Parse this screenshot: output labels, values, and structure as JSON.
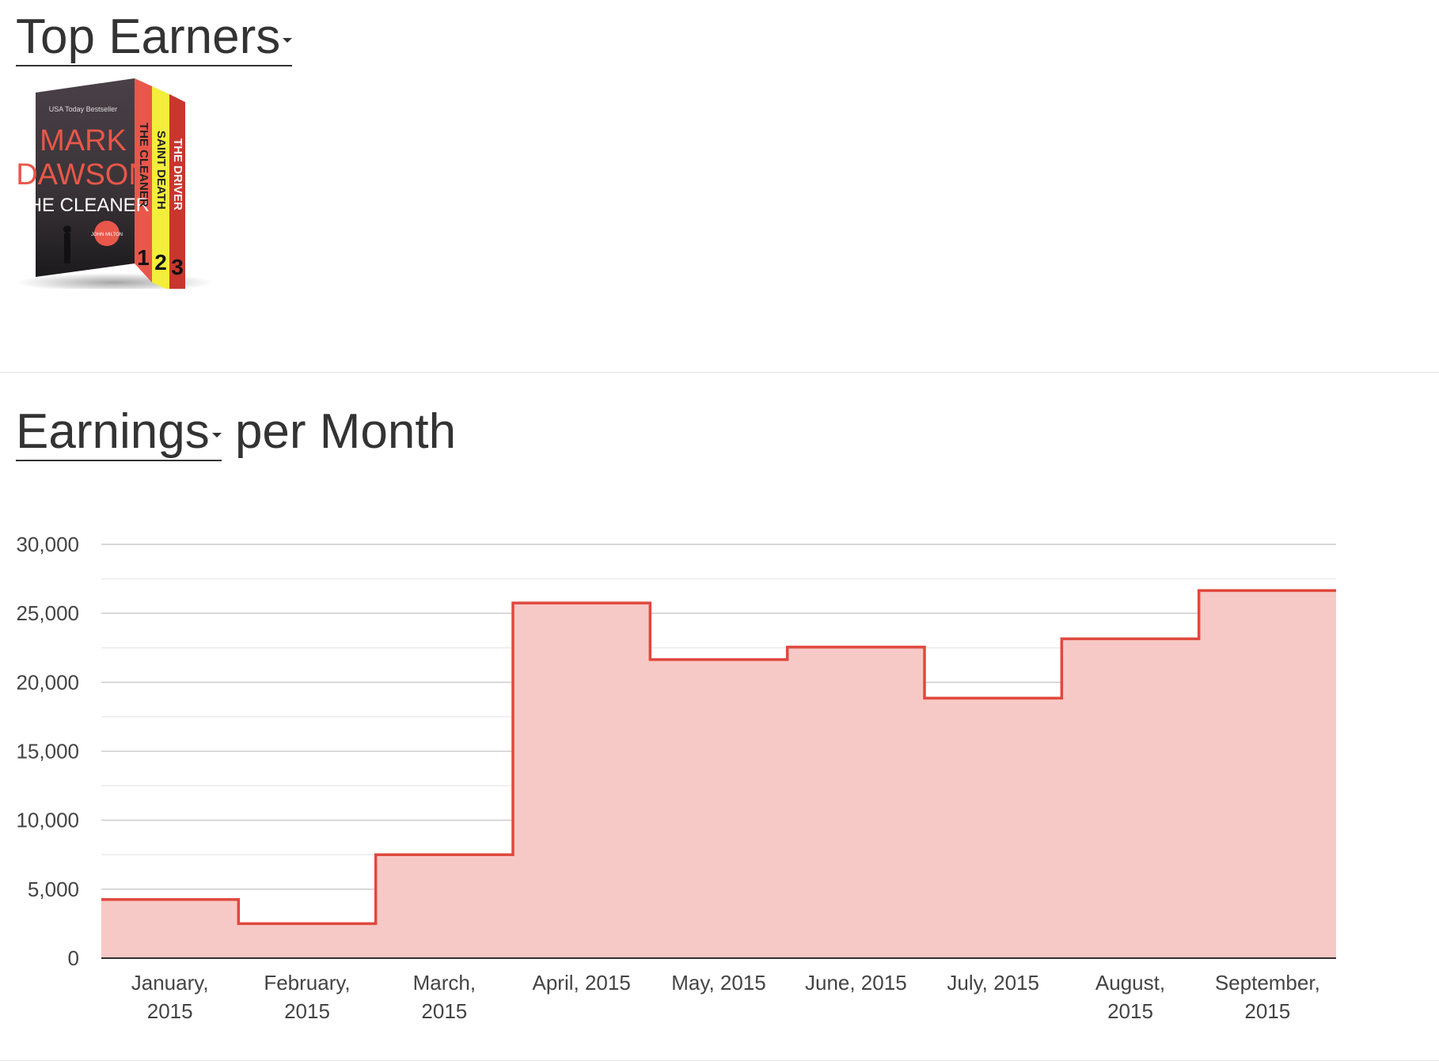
{
  "top_earners": {
    "title": "Top Earners",
    "book": {
      "top_text": "USA Today Bestseller",
      "author_first": "MARK",
      "author_last": "DAWSON",
      "series_title": "THE CLEANER",
      "badge_text": "JOHN MILTON",
      "spines": [
        {
          "title": "THE CLEANER",
          "number": "1",
          "color": "#e8574a"
        },
        {
          "title": "SAINT DEATH",
          "number": "2",
          "color": "#f3ee3b"
        },
        {
          "title": "THE DRIVER",
          "number": "3",
          "color": "#c9362e"
        }
      ]
    }
  },
  "earnings": {
    "metric_label": "Earnings",
    "title_suffix": "per Month"
  },
  "colors": {
    "line": "#e0483e",
    "fill": "#f7c9c6",
    "grid_major": "#cccccc",
    "grid_minor": "#ebebeb",
    "axis": "#333333"
  },
  "chart_data": {
    "type": "area",
    "style": "stepped",
    "categories": [
      [
        "January,",
        "2015"
      ],
      [
        "February,",
        "2015"
      ],
      [
        "March,",
        "2015"
      ],
      [
        "April, 2015"
      ],
      [
        "May, 2015"
      ],
      [
        "June, 2015"
      ],
      [
        "July, 2015"
      ],
      [
        "August,",
        "2015"
      ],
      [
        "September,",
        "2015"
      ]
    ],
    "values": [
      4250,
      2500,
      7500,
      25750,
      21650,
      22550,
      18850,
      23150,
      26650
    ],
    "ylim": [
      0,
      30000
    ],
    "yticks": [
      "0",
      "5,000",
      "10,000",
      "15,000",
      "20,000",
      "25,000",
      "30,000"
    ],
    "ytick_values": [
      0,
      5000,
      10000,
      15000,
      20000,
      25000,
      30000
    ],
    "minor_grid_step": 2500,
    "grid": true,
    "legend": "none"
  }
}
